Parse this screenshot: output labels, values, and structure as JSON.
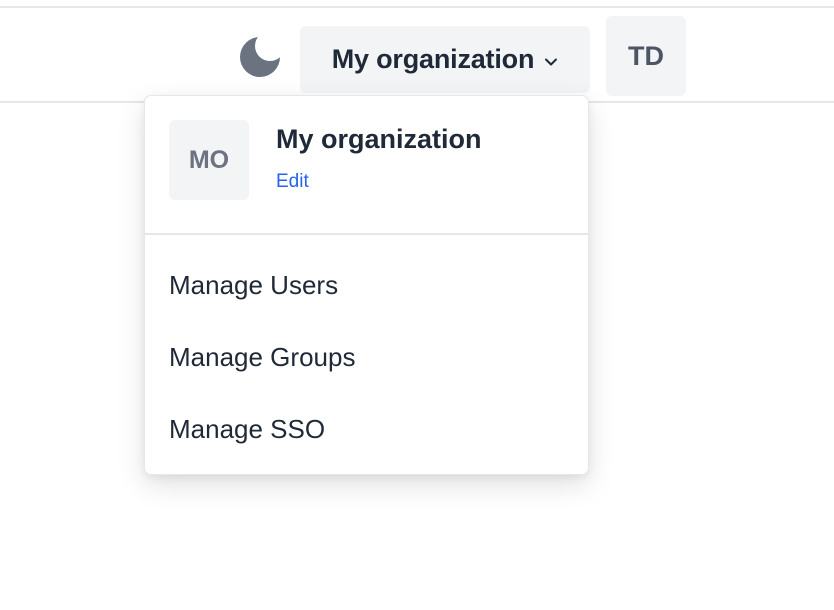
{
  "header": {
    "theme_toggle_icon": "moon-icon",
    "org_switcher": {
      "label": "My organization",
      "icon": "chevron-down-icon"
    },
    "user_avatar_initials": "TD"
  },
  "dropdown": {
    "org_avatar_initials": "MO",
    "org_name": "My organization",
    "edit_label": "Edit",
    "menu_items": [
      {
        "label": "Manage Users"
      },
      {
        "label": "Manage Groups"
      },
      {
        "label": "Manage SSO"
      }
    ]
  },
  "colors": {
    "link": "#2563eb",
    "avatar_bg": "#f3f4f6",
    "icon_gray": "#6b7280"
  }
}
